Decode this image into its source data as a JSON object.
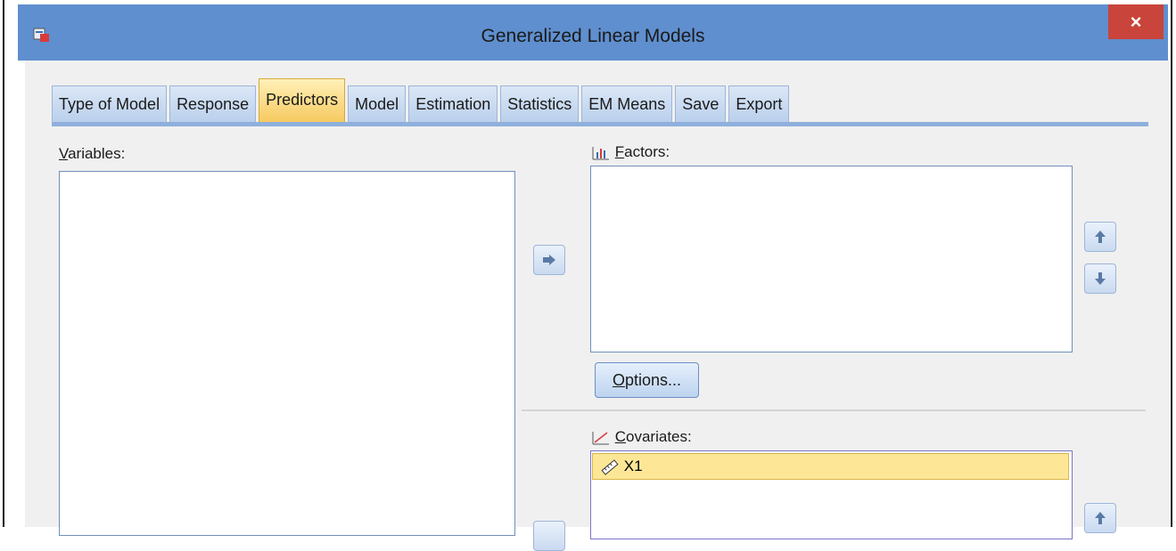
{
  "window": {
    "title": "Generalized Linear Models",
    "close_label": "×",
    "app_icon": "spss-dialog-icon"
  },
  "tabs": [
    {
      "label": "Type of Model",
      "active": false
    },
    {
      "label": "Response",
      "active": false
    },
    {
      "label": "Predictors",
      "active": true
    },
    {
      "label": "Model",
      "active": false
    },
    {
      "label": "Estimation",
      "active": false
    },
    {
      "label": "Statistics",
      "active": false
    },
    {
      "label": "EM Means",
      "active": false
    },
    {
      "label": "Save",
      "active": false
    },
    {
      "label": "Export",
      "active": false
    }
  ],
  "variables": {
    "label_mnemonic": "V",
    "label_rest": "ariables:",
    "items": []
  },
  "factors": {
    "label_mnemonic": "F",
    "label_rest": "actors:",
    "icon": "nominal-factor-icon",
    "items": []
  },
  "options_button": {
    "label_mnemonic": "O",
    "label_rest": "ptions..."
  },
  "covariates": {
    "label_mnemonic": "C",
    "label_rest": "ovariates:",
    "icon": "scale-covariate-icon",
    "items": [
      {
        "label": "X1",
        "icon": "ruler-scale-icon"
      }
    ]
  },
  "colors": {
    "titlebar": "#5f8fcf",
    "active_tab": "#f6c95e",
    "close": "#c9443a",
    "selected_item": "#fde797"
  }
}
